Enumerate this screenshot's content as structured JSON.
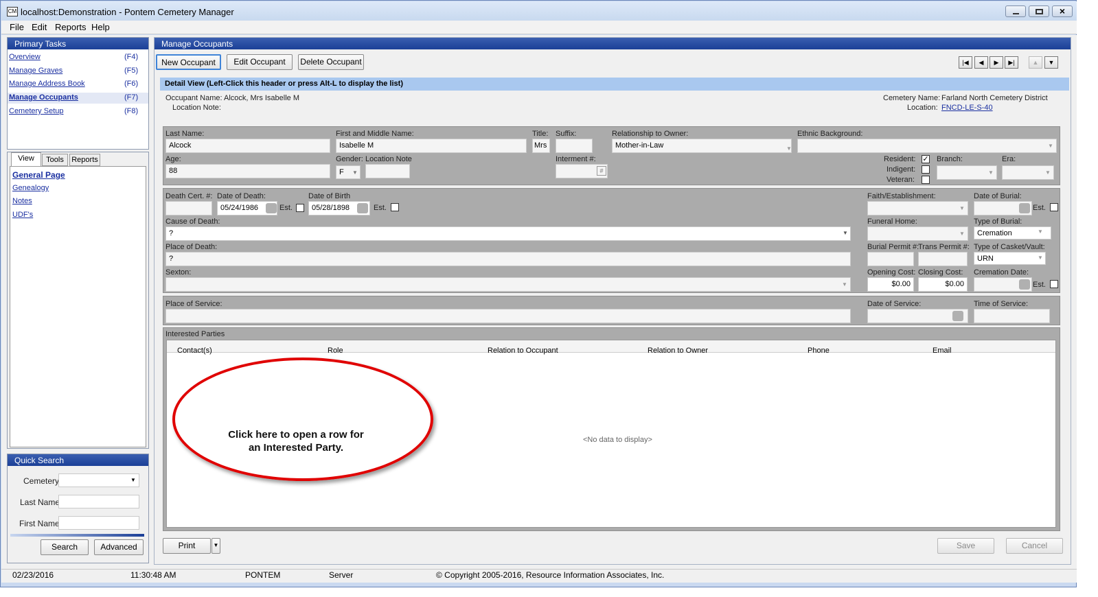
{
  "window": {
    "title": "localhost:Demonstration - Pontem Cemetery Manager",
    "app_icon": "CM"
  },
  "menu": [
    "File",
    "Edit",
    "Reports",
    "Help"
  ],
  "primary_tasks": {
    "title": "Primary Tasks",
    "items": [
      {
        "label": "Overview",
        "key": "(F4)"
      },
      {
        "label": "Manage Graves",
        "key": "(F5)"
      },
      {
        "label": "Manage Address Book",
        "key": "(F6)"
      },
      {
        "label": "Manage Occupants",
        "key": "(F7)"
      },
      {
        "label": "Cemetery Setup",
        "key": "(F8)"
      }
    ]
  },
  "view_tabs": [
    "View",
    "Tools",
    "Reports"
  ],
  "view_links": [
    "General Page",
    "Genealogy",
    "Notes",
    "UDF's"
  ],
  "quick_search": {
    "title": "Quick Search",
    "cemetery_label": "Cemetery:",
    "last_name_label": "Last Name:",
    "first_name_label": "First Name:",
    "search": "Search",
    "advanced": "Advanced"
  },
  "main": {
    "title": "Manage Occupants",
    "new": "New Occupant",
    "edit": "Edit Occupant",
    "delete": "Delete Occupant",
    "detail_header": "Detail View (Left-Click this header or press Alt-L to display the list)",
    "occupant_name": "Occupant Name: Alcock, Mrs Isabelle M",
    "location_note": "Location Note:",
    "cemetery_name_label": "Cemetery Name:",
    "cemetery_name": "Farland North Cemetery District",
    "location_label": "Location:",
    "location": "FNCD-LE-S-40"
  },
  "form": {
    "last_name_label": "Last Name:",
    "last_name": "Alcock",
    "first_label": "First and Middle Name:",
    "first": "Isabelle M",
    "title_label": "Title:",
    "title": "Mrs",
    "suffix_label": "Suffix:",
    "relationship_label": "Relationship to Owner:",
    "relationship": "Mother-in-Law",
    "ethnic_label": "Ethnic Background:",
    "age_label": "Age:",
    "age": "88",
    "gender_label": "Gender:",
    "gender": "F",
    "location_note_label": "Location Note",
    "interment_label": "Interment #:",
    "interment_icon": "#",
    "resident": "Resident:",
    "indigent": "Indigent:",
    "veteran": "Veteran:",
    "branch": "Branch:",
    "era": "Era:",
    "death_cert": "Death Cert. #:",
    "dod_label": "Date of Death:",
    "dod": "05/24/1986",
    "est": "Est.",
    "dob_label": "Date of Birth",
    "dob": "05/28/1898",
    "faith": "Faith/Establishment:",
    "burial_date": "Date of Burial:",
    "cause_label": "Cause of Death:",
    "cause": "?",
    "funeral": "Funeral Home:",
    "burial_type_label": "Type of Burial:",
    "burial_type": "Cremation",
    "place_label": "Place of Death:",
    "place": "?",
    "burial_permit": "Burial Permit #:",
    "trans_permit": "Trans Permit #:",
    "casket_label": "Type of Casket/Vault:",
    "casket": "URN",
    "sexton": "Sexton:",
    "opening_label": "Opening Cost:",
    "opening": "$0.00",
    "closing_label": "Closing Cost:",
    "closing": "$0.00",
    "cremation": "Cremation Date:",
    "service_place": "Place of Service:",
    "service_date": "Date of Service:",
    "service_time": "Time of Service:"
  },
  "parties": {
    "title": "Interested Parties",
    "columns": [
      "Contact(s)",
      "Role",
      "Relation to Occupant",
      "Relation to Owner",
      "Phone",
      "Email"
    ],
    "empty": "<No data to display>",
    "callout": "Click here to open a row for an Interested Party."
  },
  "footer": {
    "print": "Print",
    "save": "Save",
    "cancel": "Cancel"
  },
  "status": {
    "date": "02/23/2016",
    "time": "11:30:48 AM",
    "user": "PONTEM",
    "mode": "Server",
    "copyright": "© Copyright 2005-2016, Resource Information Associates, Inc."
  },
  "colors": {
    "accent": "#1b3f97",
    "detail_header": "#a9c8ef",
    "callout": "#e00000"
  }
}
